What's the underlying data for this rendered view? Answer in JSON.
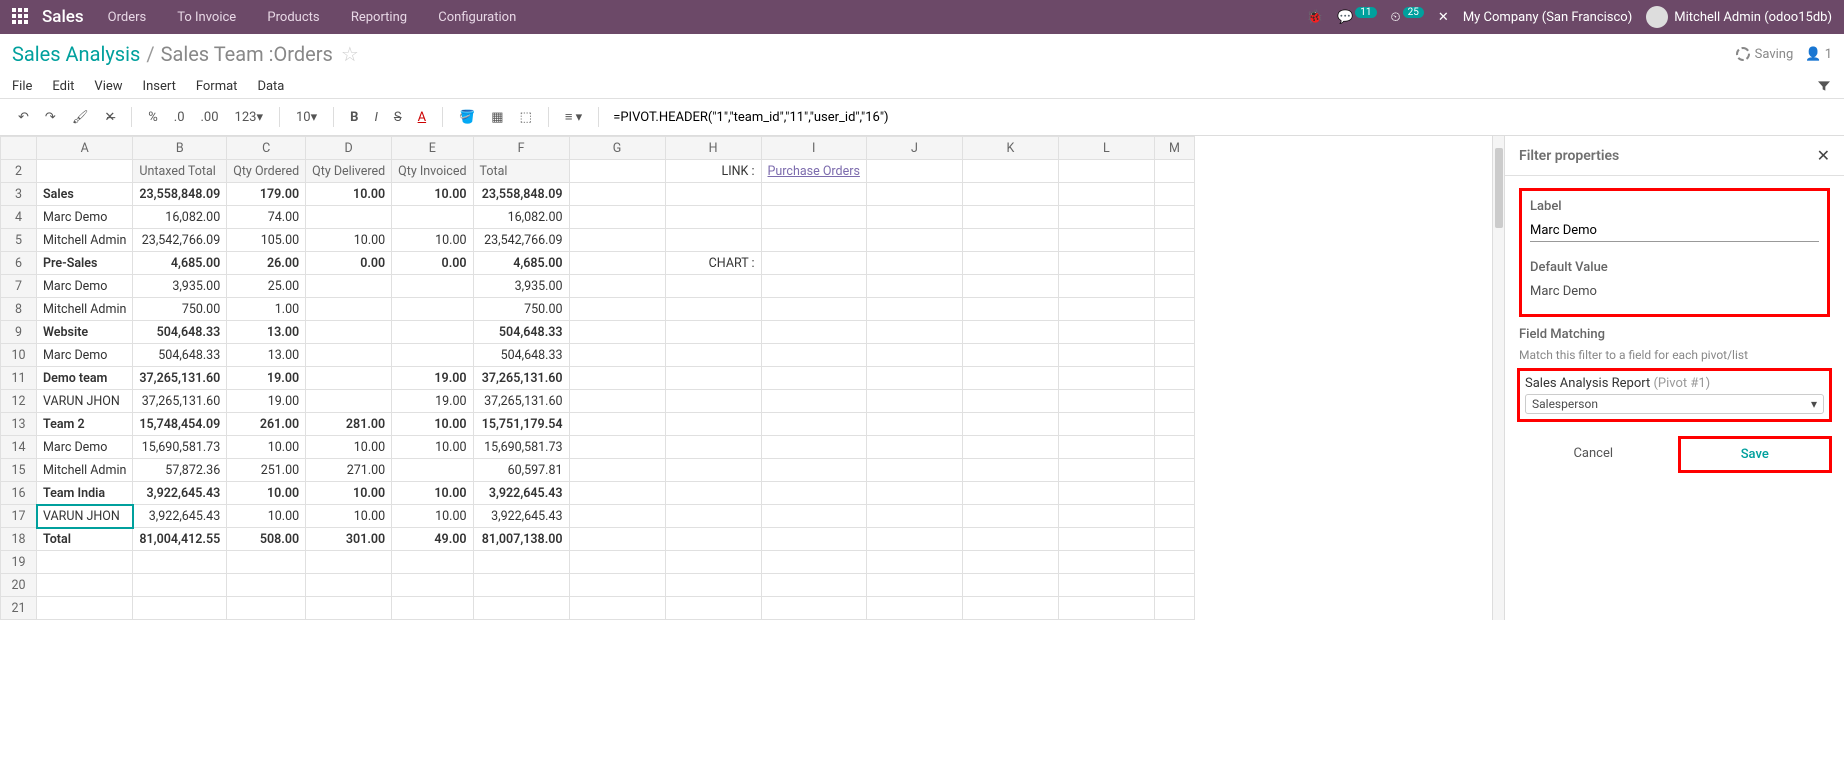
{
  "topbar": {
    "brand": "Sales",
    "menu": [
      "Orders",
      "To Invoice",
      "Products",
      "Reporting",
      "Configuration"
    ],
    "messages_badge": "11",
    "activities_badge": "25",
    "company": "My Company (San Francisco)",
    "user": "Mitchell Admin (odoo15db)"
  },
  "breadcrumb": {
    "root": "Sales Analysis",
    "current": "Sales Team :Orders",
    "saving": "Saving",
    "users": "1"
  },
  "menubar": [
    "File",
    "Edit",
    "View",
    "Insert",
    "Format",
    "Data"
  ],
  "toolbar": {
    "font_size": "10",
    "nums": "123",
    "formula": "=PIVOT.HEADER(\"1\",\"team_id\",\"11\",\"user_id\",\"16\")"
  },
  "columns": [
    "A",
    "B",
    "C",
    "D",
    "E",
    "F",
    "G",
    "H",
    "I",
    "J",
    "K",
    "L",
    "M"
  ],
  "sheet": {
    "headers_row": {
      "row": 2,
      "b": "Untaxed Total",
      "c": "Qty Ordered",
      "d": "Qty Delivered",
      "e": "Qty Invoiced",
      "f": "Total",
      "h": "LINK :",
      "i": "Purchase Orders"
    },
    "rows": [
      {
        "n": 3,
        "a": "Sales",
        "bold": true,
        "b": "23,558,848.09",
        "c": "179.00",
        "d": "10.00",
        "e": "10.00",
        "f": "23,558,848.09"
      },
      {
        "n": 4,
        "a": "Marc Demo",
        "b": "16,082.00",
        "c": "74.00",
        "d": "",
        "e": "",
        "f": "16,082.00"
      },
      {
        "n": 5,
        "a": "Mitchell Admin",
        "b": "23,542,766.09",
        "c": "105.00",
        "d": "10.00",
        "e": "10.00",
        "f": "23,542,766.09"
      },
      {
        "n": 6,
        "a": "Pre-Sales",
        "bold": true,
        "b": "4,685.00",
        "c": "26.00",
        "d": "0.00",
        "e": "0.00",
        "f": "4,685.00",
        "h": "CHART :"
      },
      {
        "n": 7,
        "a": "Marc Demo",
        "b": "3,935.00",
        "c": "25.00",
        "d": "",
        "e": "",
        "f": "3,935.00"
      },
      {
        "n": 8,
        "a": "Mitchell Admin",
        "b": "750.00",
        "c": "1.00",
        "d": "",
        "e": "",
        "f": "750.00"
      },
      {
        "n": 9,
        "a": "Website",
        "bold": true,
        "b": "504,648.33",
        "c": "13.00",
        "d": "",
        "e": "",
        "f": "504,648.33"
      },
      {
        "n": 10,
        "a": "Marc Demo",
        "b": "504,648.33",
        "c": "13.00",
        "d": "",
        "e": "",
        "f": "504,648.33"
      },
      {
        "n": 11,
        "a": "Demo team",
        "bold": true,
        "b": "37,265,131.60",
        "c": "19.00",
        "d": "",
        "e": "19.00",
        "f": "37,265,131.60"
      },
      {
        "n": 12,
        "a": "VARUN JHON",
        "b": "37,265,131.60",
        "c": "19.00",
        "d": "",
        "e": "19.00",
        "f": "37,265,131.60"
      },
      {
        "n": 13,
        "a": "Team 2",
        "bold": true,
        "b": "15,748,454.09",
        "c": "261.00",
        "d": "281.00",
        "e": "10.00",
        "f": "15,751,179.54"
      },
      {
        "n": 14,
        "a": "Marc Demo",
        "b": "15,690,581.73",
        "c": "10.00",
        "d": "10.00",
        "e": "10.00",
        "f": "15,690,581.73"
      },
      {
        "n": 15,
        "a": "Mitchell Admin",
        "b": "57,872.36",
        "c": "251.00",
        "d": "271.00",
        "e": "",
        "f": "60,597.81"
      },
      {
        "n": 16,
        "a": "Team India",
        "bold": true,
        "b": "3,922,645.43",
        "c": "10.00",
        "d": "10.00",
        "e": "10.00",
        "f": "3,922,645.43"
      },
      {
        "n": 17,
        "a": "VARUN JHON",
        "selected": true,
        "b": "3,922,645.43",
        "c": "10.00",
        "d": "10.00",
        "e": "10.00",
        "f": "3,922,645.43"
      },
      {
        "n": 18,
        "a": "Total",
        "bold": true,
        "b": "81,004,412.55",
        "c": "508.00",
        "d": "301.00",
        "e": "49.00",
        "f": "81,007,138.00"
      },
      {
        "n": 19
      },
      {
        "n": 20
      },
      {
        "n": 21
      }
    ]
  },
  "panel": {
    "title": "Filter properties",
    "label_title": "Label",
    "label_value": "Marc Demo",
    "default_title": "Default Value",
    "default_value": "Marc Demo",
    "field_matching_title": "Field Matching",
    "field_matching_desc": "Match this filter to a field for each pivot/list",
    "pivot_name": "Sales Analysis Report",
    "pivot_suffix": "(Pivot #1)",
    "select_value": "Salesperson",
    "cancel": "Cancel",
    "save": "Save"
  }
}
